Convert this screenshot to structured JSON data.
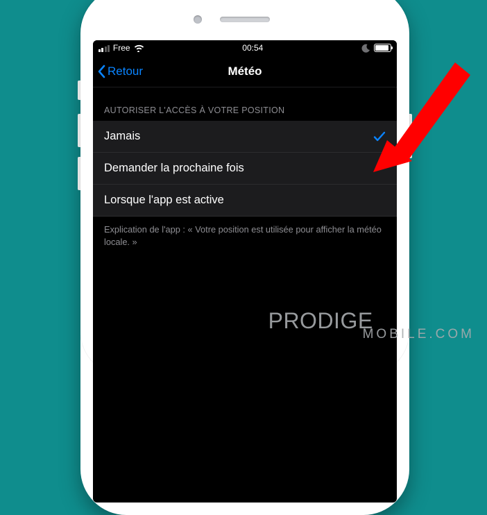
{
  "status_bar": {
    "carrier": "Free",
    "time": "00:54"
  },
  "nav": {
    "back_label": "Retour",
    "title": "Météo"
  },
  "section": {
    "header": "AUTORISER L'ACCÈS À VOTRE POSITION",
    "options": [
      {
        "label": "Jamais",
        "selected": true
      },
      {
        "label": "Demander la prochaine fois",
        "selected": false
      },
      {
        "label": "Lorsque l'app est active",
        "selected": false
      }
    ],
    "footer": "Explication de l'app : « Votre position est utilisée pour afficher la météo locale. »"
  },
  "watermark": {
    "line1": "PRODIGE",
    "line2": "MOBILE.COM"
  },
  "colors": {
    "accent": "#0a84ff",
    "arrow": "#ff0000"
  }
}
